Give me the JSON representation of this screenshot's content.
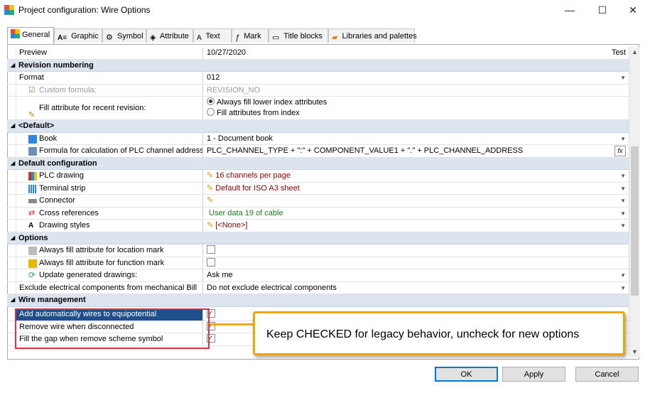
{
  "window": {
    "title": "Project configuration: Wire Options",
    "controls": {
      "minimize": "—",
      "maximize": "☐",
      "close": "✕"
    }
  },
  "tabs": [
    {
      "label": "General",
      "icon": "general-icon",
      "active": true
    },
    {
      "label": "Graphic",
      "icon": "graphic-icon"
    },
    {
      "label": "Symbol",
      "icon": "symbol-icon"
    },
    {
      "label": "Attribute",
      "icon": "attribute-icon"
    },
    {
      "label": "Text",
      "icon": "text-icon"
    },
    {
      "label": "Mark",
      "icon": "mark-icon"
    },
    {
      "label": "Title blocks",
      "icon": "title-blocks-icon"
    },
    {
      "label": "Libraries and palettes",
      "icon": "libraries-icon"
    }
  ],
  "grid": {
    "preview": {
      "label": "Preview",
      "value": "10/27/2020",
      "extra": "Test"
    },
    "revision": {
      "header": "Revision numbering",
      "format_label": "Format",
      "format_value": "012",
      "custom_label": "Custom formula:",
      "custom_value": "REVISION_NO",
      "fill_label": "Fill attribute for recent revision:",
      "option1": "Always fill lower index attributes",
      "option2": "Fill attributes from index"
    },
    "default": {
      "header": "<Default>",
      "book_label": "Book",
      "book_value": "1 - Document book",
      "formula_label": "Formula for calculation of PLC channel address",
      "formula_value": "PLC_CHANNEL_TYPE + \":\" + COMPONENT_VALUE1 + \".\" + PLC_CHANNEL_ADDRESS",
      "fx": "fx"
    },
    "defconf": {
      "header": "Default configuration",
      "plc_label": "PLC drawing",
      "plc_value": "16 channels per page",
      "terminal_label": "Terminal strip",
      "terminal_value": "Default for ISO A3 sheet",
      "connector_label": "Connector",
      "connector_value": "",
      "cross_label": "Cross references",
      "cross_value": "User data 19 of cable",
      "styles_label": "Drawing styles",
      "styles_value": "[<None>]"
    },
    "options": {
      "header": "Options",
      "loc_label": "Always fill attribute for location mark",
      "func_label": "Always fill attribute for function mark",
      "update_label": "Update generated drawings:",
      "update_value": "Ask me",
      "exclude_label": "Exclude electrical components from mechanical Bill",
      "exclude_value": "Do not exclude electrical components"
    },
    "wire": {
      "header": "Wire management",
      "add_label": "Add automatically wires to equipotential",
      "remove_label": "Remove wire when disconnected",
      "fill_label": "Fill the gap when remove scheme symbol"
    }
  },
  "callout": {
    "text": "Keep CHECKED for legacy behavior, uncheck for new options"
  },
  "buttons": {
    "ok": "OK",
    "apply": "Apply",
    "cancel": "Cancel"
  },
  "colors": {
    "accent": "#f0a500",
    "highlight_box": "#e0303a",
    "selected_row": "#1f4e8c",
    "category_bg": "#dce4ef"
  }
}
